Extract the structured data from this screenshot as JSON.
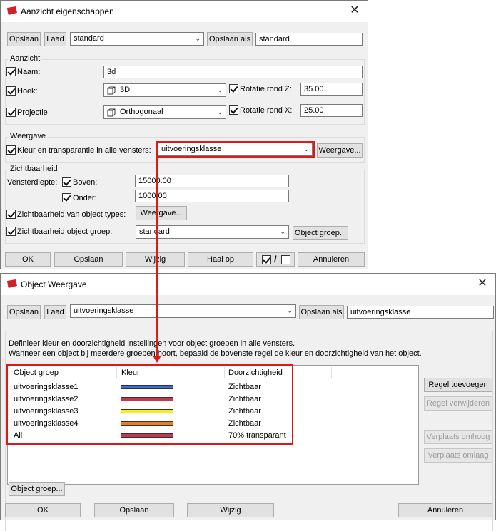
{
  "window1": {
    "title": "Aanzicht eigenschappen",
    "toolbar": {
      "save_label": "Opslaan",
      "load_label": "Laad",
      "preset_value": "standard",
      "save_as_label": "Opslaan als",
      "save_as_value": "standard"
    },
    "aanzicht": {
      "group_label": "Aanzicht",
      "name_label": "Naam:",
      "name_value": "3d",
      "angle_label": "Hoek:",
      "angle_value": "3D",
      "rotz_label": "Rotatie rond Z:",
      "rotz_value": "35.00",
      "projection_label": "Projectie",
      "projection_value": "Orthogonaal",
      "rotx_label": "Rotatie rond X:",
      "rotx_value": "25.00"
    },
    "weergave": {
      "group_label": "Weergave",
      "color_label": "Kleur en transparantie in alle vensters:",
      "color_value": "uitvoeringsklasse",
      "button_label": "Weergave..."
    },
    "zicht": {
      "group_label": "Zichtbaarheid",
      "depth_label": "Vensterdiepte:",
      "top_label": "Boven:",
      "top_value": "15000.00",
      "bottom_label": "Onder:",
      "bottom_value": "1000.00",
      "types_label": "Zichtbaarheid van object types:",
      "types_button": "Weergave...",
      "group_label2": "Zichtbaarheid object groep:",
      "group_value": "standard",
      "group_button": "Object groep..."
    },
    "footer": {
      "ok": "OK",
      "save": "Opslaan",
      "modify": "Wijzig",
      "fetch": "Haal op",
      "toggle": "/",
      "cancel": "Annuleren"
    }
  },
  "window2": {
    "title": "Object Weergave",
    "toolbar": {
      "save_label": "Opslaan",
      "load_label": "Laad",
      "preset_value": "uitvoeringsklasse",
      "save_as_label": "Opslaan als",
      "save_as_value": "uitvoeringsklasse"
    },
    "description": {
      "line1": "Definieer kleur en doorzichtigheid instellingen voor object groepen in alle vensters.",
      "line2": "Wanneer een object bij meerdere groepen hoort, bepaald de bovenste regel de kleur en doorzichtigheid van het object."
    },
    "table": {
      "columns": [
        "Object groep",
        "Kleur",
        "Doorzichtigheid"
      ],
      "rows": [
        {
          "group": "uitvoeringsklasse1",
          "color": "#3a6fd8",
          "transparency": "Zichtbaar"
        },
        {
          "group": "uitvoeringsklasse2",
          "color": "#c0394f",
          "transparency": "Zichtbaar"
        },
        {
          "group": "uitvoeringsklasse3",
          "color": "#f2ef2a",
          "transparency": "Zichtbaar"
        },
        {
          "group": "uitvoeringsklasse4",
          "color": "#f07c20",
          "transparency": "Zichtbaar"
        },
        {
          "group": "All",
          "color": "#c0394f",
          "transparency": "70% transparant"
        }
      ]
    },
    "side_buttons": {
      "add": "Regel toevoegen",
      "remove": "Regel verwijderen",
      "up": "Verplaats omhoog",
      "down": "Verplaats omlaag"
    },
    "object_group_button": "Object groep...",
    "footer": {
      "ok": "OK",
      "save": "Opslaan",
      "modify": "Wijzig",
      "cancel": "Annuleren"
    }
  },
  "colors": {
    "highlight": "#e01818",
    "app_icon": "#d4202a"
  }
}
